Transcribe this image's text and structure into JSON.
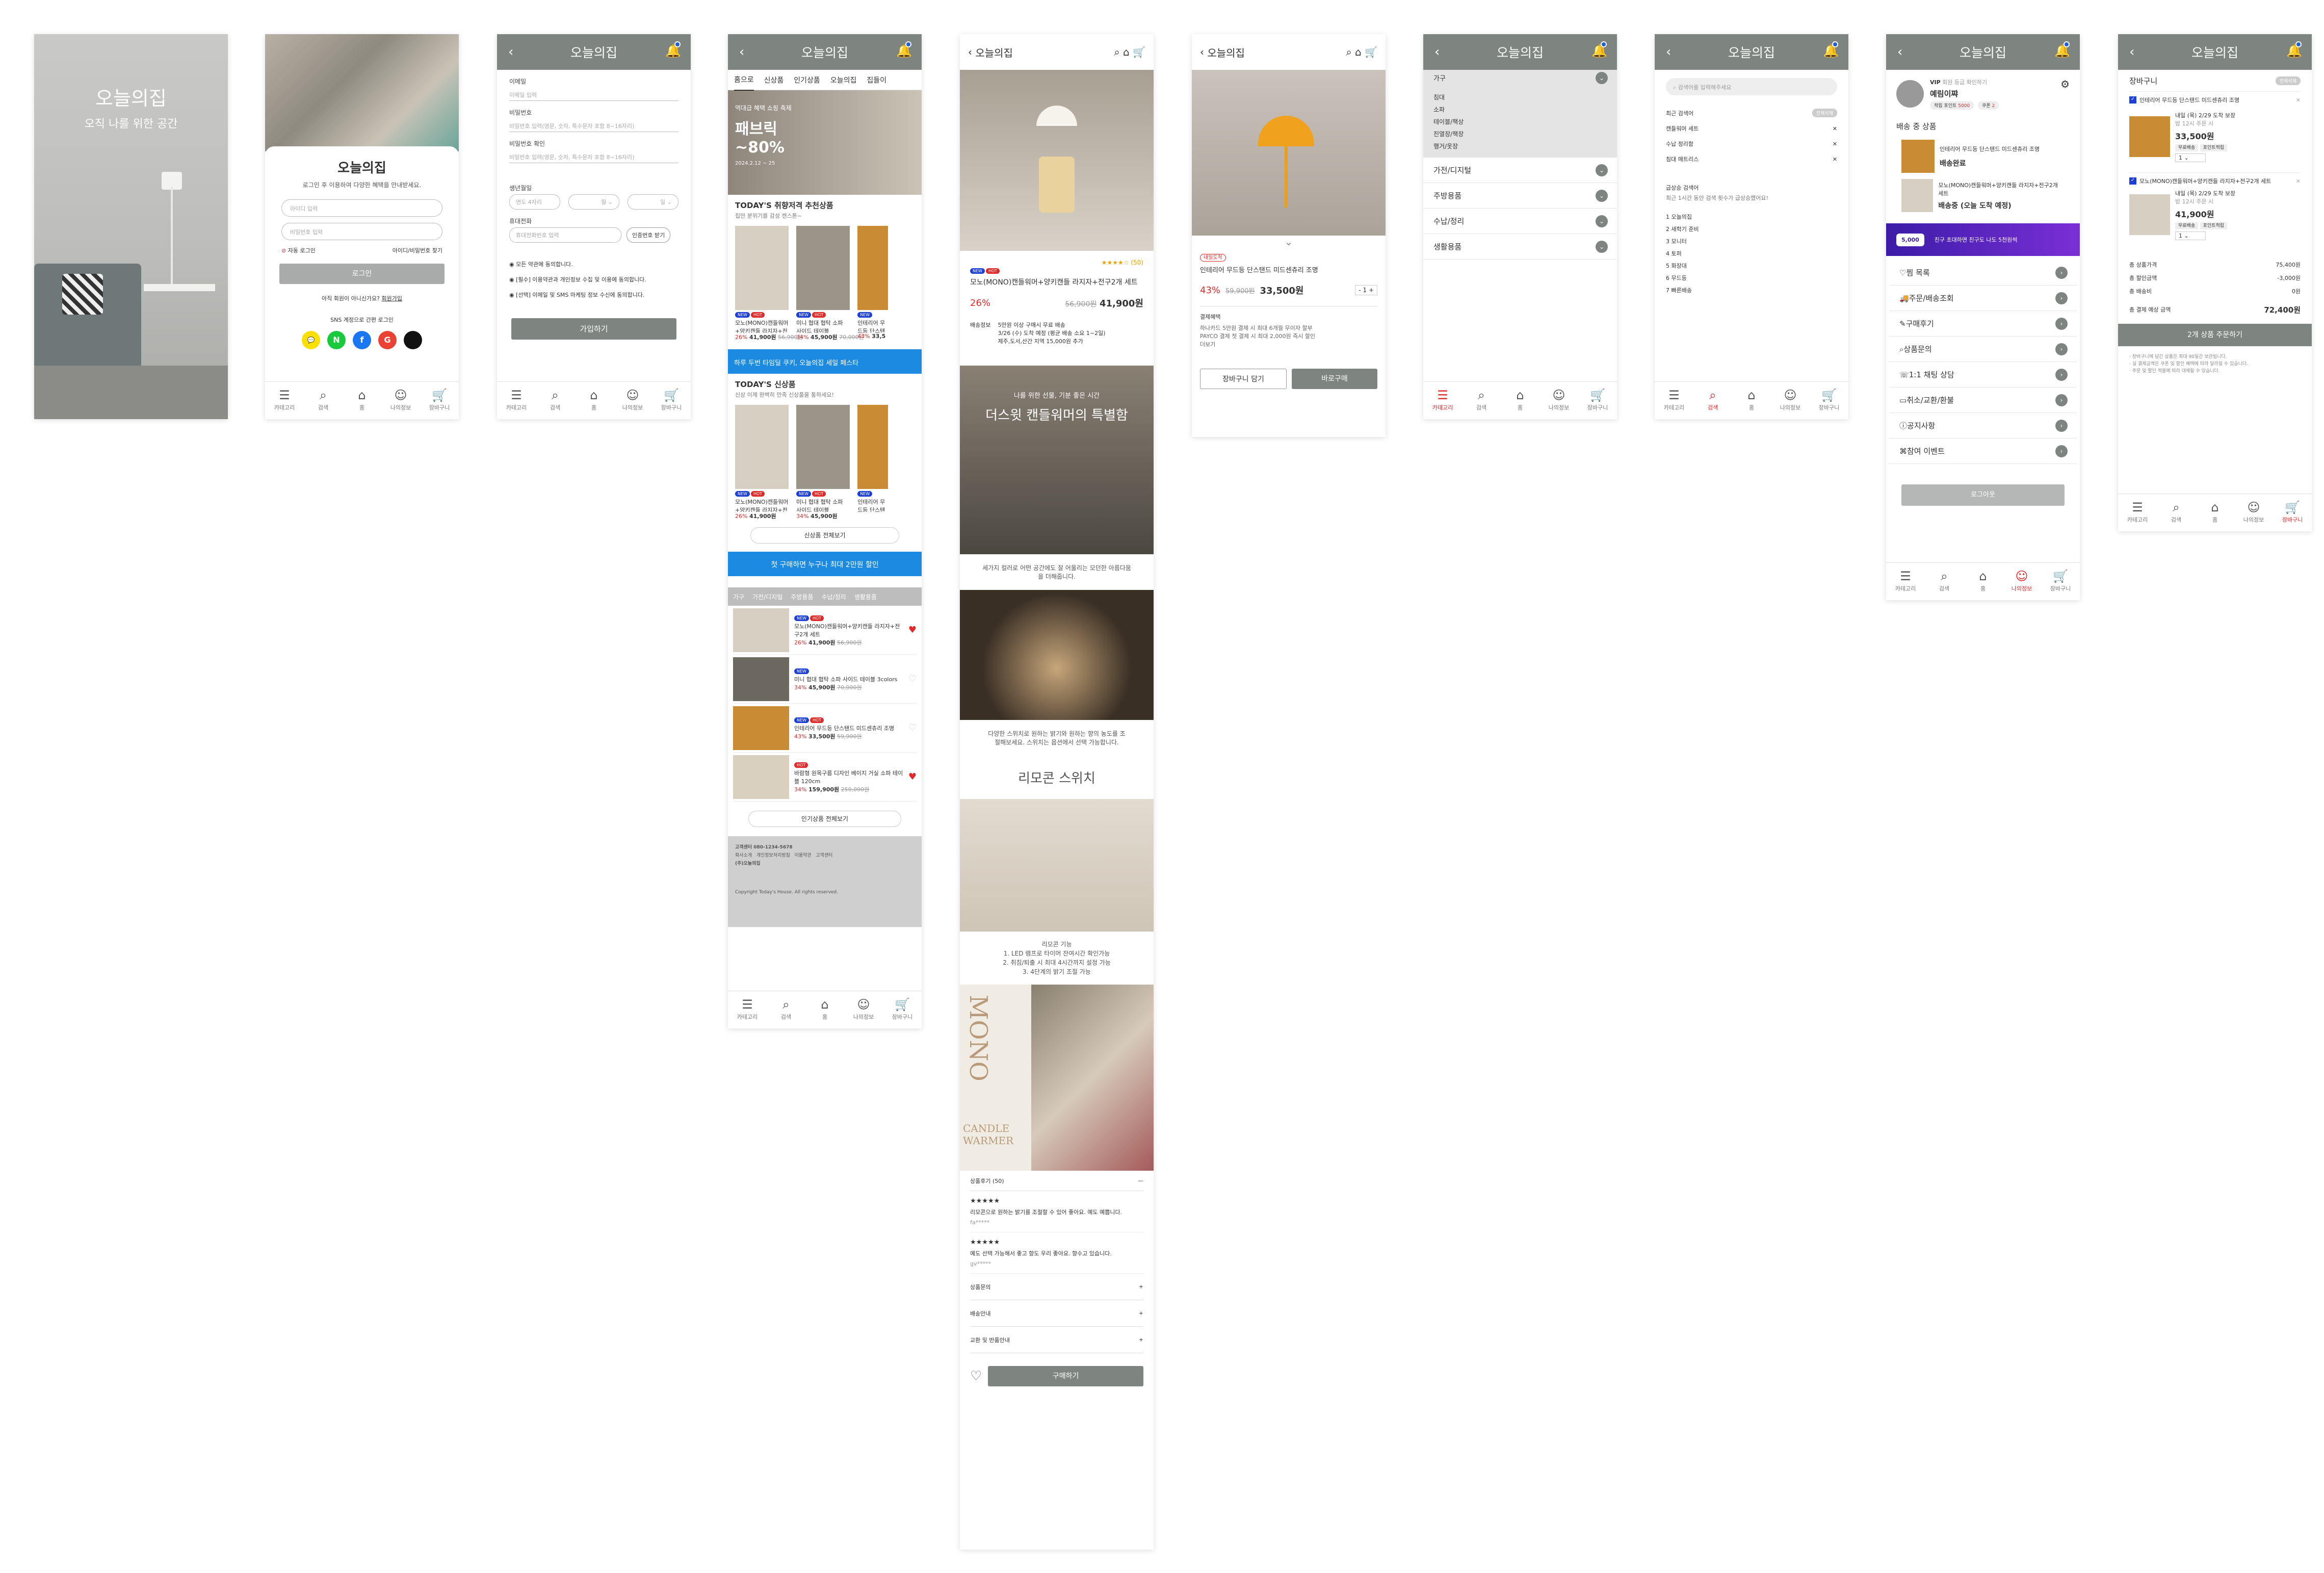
{
  "app": "오늘의집",
  "splash": {
    "title": "오늘의집",
    "subtitle": "오직 나를 위한 공간"
  },
  "login": {
    "title": "오늘의집",
    "desc": "로그인 후 이용하여 다양한 혜택을 안내받세요.",
    "id_ph": "아이디 입력",
    "pw_ph": "비밀번호 입력",
    "auto": "자동 로그인",
    "find": "아이디/비밀번호 찾기",
    "btn": "로그인",
    "signup_q": "아직 회원이 아니신가요?",
    "signup": "회원가입",
    "sns": "SNS 계정으로 간편 로그인"
  },
  "join": {
    "email": "이메일",
    "email_ph": "이메일 입력",
    "pw": "비밀번호",
    "pw_ph": "비밀번호 입력(영문, 숫자, 특수문자 포함 8~16자리)",
    "pw2": "비밀번호 확인",
    "pw2_ph": "비밀번호 입력(영문, 숫자, 특수문자 포함 8~16자리)",
    "birth": "생년월일",
    "year": "연도 4자리",
    "month": "월",
    "day": "일",
    "phone": "휴대전화",
    "phone_ph": "휴대전화번호 입력",
    "verify": "인증번호 받기",
    "agree": [
      "모든 약관에 동의합니다.",
      "[필수] 이용약관과 개인정보 수집 및 이용에 동의합니다.",
      "[선택] 이메일 및 SMS 마케팅 정보 수신에 동의합니다."
    ],
    "btn": "가입하기"
  },
  "home": {
    "tabs": [
      "홈으로",
      "신상품",
      "인기상품",
      "오늘의집",
      "집들이"
    ],
    "banner": {
      "line": "역대급 혜택 쇼핑 축제",
      "title": "패브릭",
      "pct": "~80%",
      "date": "2024.2.12 ~ 25"
    },
    "rec_title": "TODAY'S 취향저격 추천상품",
    "rec_sub": "집안 분위기를 감성 캔스톤~",
    "products": [
      {
        "name": "모노(MONO)캔들워머+양키캔들 라지자+전구2개 세트",
        "pct": "26%",
        "price": "41,900원",
        "old": "56,900원"
      },
      {
        "name": "미니 협대 협탁 소파 사이드 테이블 3colors",
        "pct": "34%",
        "price": "45,900원",
        "old": "70,000원"
      },
      {
        "name": "인테리어 무드등 단스탠드 미드센츄리",
        "pct": "43%",
        "price": "33,5"
      }
    ],
    "promo1": "하루 두번 타임딜 쿠키, 오늘의집 세일 페스타",
    "new_title": "TODAY'S 신상품",
    "new_sub": "신상 이제 완벽히 만족 신상품을 통하세요!",
    "new_more": "신상품 전체보기",
    "promo2": "첫 구매하면 누구나 최대 2만원 할인",
    "cat_tabs": [
      "가구",
      "가전/디지털",
      "주방용품",
      "수납/정리",
      "생활용품"
    ],
    "list": [
      {
        "name": "모노(MONO)캔들워머+양키캔들 라지자+전구2개 세트",
        "pct": "26%",
        "price": "41,900원",
        "old": "56,900원"
      },
      {
        "name": "미니 협대 협탁 소파 사이드 테이블 3colors",
        "pct": "34%",
        "price": "45,900원",
        "old": "70,000원"
      },
      {
        "name": "인테리어 무드등 단스탠드 미드센츄리 조명",
        "pct": "43%",
        "price": "33,500원",
        "old": "59,900원"
      },
      {
        "name": "바람형 원목구름 디자인 베이지 거실 소파 테이블 120cm",
        "pct": "34%",
        "price": "159,900원",
        "old": "250,000원"
      }
    ],
    "pop_more": "인기상품 전체보기",
    "footer": [
      "고객센터 080-1234-5678",
      "회사소개",
      "개인정보처리방침",
      "이용약관",
      "고객센터",
      "(주)오늘의집",
      "Copyright Today's House. All rights reserved."
    ]
  },
  "detail1": {
    "name": "모노(MONO)캔들워머+양키캔들 라지자+전구2개 세트",
    "rating": "★★★★☆ (50)",
    "pct": "26%",
    "old": "56,900원",
    "price": "41,900원",
    "ship_l": "배송정보",
    "ship": "5만원 이상 구매시 무료 배송\n3/26 (수) 도착 예정 (평균 배송 소요 1~2일)\n제주,도서,산간 지역 15,000원 추가",
    "hero1": "나를 위한 선물, 기분 좋은 시간",
    "hero2": "더스윗 캔들워머의 특별함",
    "txt1": "세가지 컬러로 어떤 공간에도 잘 어울리는 모던한 아름다움을 더해줍니다.",
    "txt2": "다양한 스위치로 원하는 밝기와 원하는 향의 농도를 조절해보세요. 스위치는 옵션에서 선택 가능합니다.",
    "rc": "리모콘 스위치",
    "rc_f": "리모콘 기능",
    "rc_list": [
      "1. LED 램프로 타이머 잔여시간 확인가능",
      "2. 취침/퇴출 시 최대 4시간까지 설정 가능",
      "3. 4단계의 밝기 조절 가능"
    ],
    "mono": "MONO",
    "cw": "CANDLE WARMER",
    "rev_t": "상품후기 (50)",
    "reviews": [
      {
        "s": "★★★★★",
        "t": "리모콘으로 원하는 밝기를 조절할 수 있어 좋아요. 예도 예쁩니다.",
        "u": "fa*****"
      },
      {
        "s": "★★★★★",
        "t": "예도 선택 가능해서 좋고 향도 우리 좋아요. 향수고 있습니다.",
        "u": "gv*****"
      }
    ],
    "acc": [
      "상품문의",
      "배송안내",
      "교환 및 반품안내"
    ],
    "buy": "구매하기"
  },
  "detail2": {
    "badge": "내일도착",
    "name": "인테리어 무드등 단스탠드 미드센츄리 조명",
    "pct": "43%",
    "old": "59,900원",
    "price": "33,500원",
    "qty": "1",
    "benefit_t": "결제혜택",
    "benefit": "하나카드 5만원 결제 시 최대 6개월 무이자 할부\nPAYCO 결제 첫 결제 시 최대 2,000원 즉시 할인",
    "more": "더보기",
    "cart": "장바구니 담기",
    "buy": "바로구매"
  },
  "category": {
    "items": [
      "가구",
      "가전/디지털",
      "주방용품",
      "수납/정리",
      "생활용품"
    ],
    "sub": [
      "침대",
      "소파",
      "테이블/책상",
      "진열장/책장",
      "행거/옷장"
    ]
  },
  "search": {
    "ph": "검색어를 입력해주세요",
    "recent_t": "최근 검색어",
    "clear": "전체삭제",
    "recent": [
      "캔들워머 세트",
      "수납 정리함",
      "침대 매트리스"
    ],
    "hot_t": "급상승 검색어",
    "hot_sub": "최근 1시간 동안 검색 횟수가 급상승했어요!",
    "hot": [
      "1 오늘의집",
      "2 새학기 준비",
      "3 모니터",
      "4 토퍼",
      "5 화장대",
      "6 무드등",
      "7 빠른배송"
    ]
  },
  "mypage": {
    "grade": "VIP",
    "grade_txt": "회원 등급 확인하기",
    "name": "예림이쨔",
    "pt_l": "적립 포인트",
    "pt": "5000",
    "cp_l": "쿠폰",
    "cp": "2",
    "ship_t": "배송 중 상품",
    "ship": [
      {
        "name": "인테리어 무드등 단스탠드 미드센츄리 조명",
        "state": "배송완료"
      },
      {
        "name": "모노(MONO)캔들워머+양키캔들 라지자+전구2개 세트",
        "state": "배송중 (오늘 도착 예정)"
      }
    ],
    "banner": "친구 초대하면 친구도 나도 5천원씩",
    "banner_amt": "5,000",
    "menu": [
      "찜 목록",
      "주문/배송조회",
      "구매후기",
      "상품문의",
      "1:1 채팅 상담",
      "취소/교환/환불",
      "공지사항",
      "참여 이벤트"
    ],
    "logout": "로그아웃"
  },
  "cart": {
    "title": "장바구니",
    "del": "전체삭제",
    "items": [
      {
        "name": "인테리어 무드등 단스탠드 미드센츄리 조명",
        "date": "내일 (목) 2/29 도착 보장",
        "time": "밤 12시 주문 시",
        "price": "33,500원",
        "ship": "무료배송",
        "pt": "포인트적립",
        "qty": "1"
      },
      {
        "name": "모노(MONO)캔들워머+양키캔들 라지자+전구2개 세트",
        "date": "내일 (목) 2/29 도착 보장",
        "time": "밤 12시 주문 시",
        "price": "41,900원",
        "ship": "무료배송",
        "pt": "포인트적립",
        "qty": "1"
      }
    ],
    "sum": [
      [
        "총 상품가격",
        "75,400원"
      ],
      [
        "총 할인금액",
        "-3,000원"
      ],
      [
        "총 배송비",
        "0원"
      ]
    ],
    "total_l": "총 결제 예상 금액",
    "total": "72,400원",
    "btn": "2개 상품 주문하기",
    "notes": "· 장바구니에 담긴 상품은 최대 90일간 보관됩니다.\n· 실 결제금액은 쿠폰 및 할인 혜택에 따라 달라질 수 있습니다.\n· 주문 및 할인 적용에 따라 대체될 수 있습니다."
  },
  "nav": [
    "카테고리",
    "검색",
    "홈",
    "나의정보",
    "장바구니"
  ]
}
